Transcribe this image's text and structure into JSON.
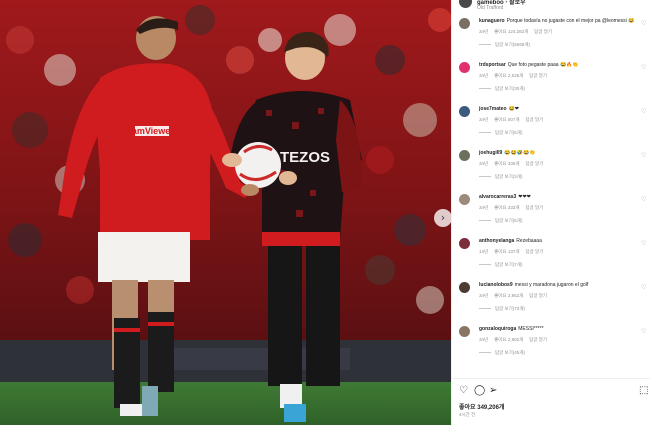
{
  "post": {
    "owner": "gameboo",
    "dot": "•",
    "follow_label": "팔로우",
    "location": "Old Trafford",
    "more_icon": "more-icon"
  },
  "photo": {
    "shirt_text": "TEZOS",
    "sponsor_text": "TeamViewer",
    "next_icon": "chevron-right-icon"
  },
  "comments": [
    {
      "user": "kunaguero",
      "text": "Porque todavía no jugaste con el mejor pa @leomessi 😂",
      "age": "34년",
      "likes": "좋아요 124,282개",
      "reply": "답글 달기",
      "replies": "답글 보기(5668개)",
      "avatar_color": "#7a6f63"
    },
    {
      "user": "trdsportsar",
      "text": "Que foto pegaste paaa 😂🔥👏",
      "age": "34년",
      "likes": "좋아요 2,535개",
      "reply": "답글 달기",
      "replies": "답글 보기(30개)",
      "avatar_color": "#e1306c"
    },
    {
      "user": "jose7mateo",
      "text": "😂❤",
      "age": "34년",
      "likes": "좋아요 507개",
      "reply": "답글 달기",
      "replies": "답글 보기(5개)",
      "avatar_color": "#3d5a80"
    },
    {
      "user": "joehugill9",
      "text": "😂😂🤣😂👏",
      "age": "34년",
      "likes": "좋아요 336개",
      "reply": "답글 달기",
      "replies": "답글 보기(3개)",
      "avatar_color": "#6b705c"
    },
    {
      "user": "alvarocarreras3",
      "text": "❤❤❤",
      "age": "34년",
      "likes": "좋아요 333개",
      "reply": "답글 달기",
      "replies": "답글 보기(5개)",
      "avatar_color": "#9c8b7a"
    },
    {
      "user": "anthonyelanga",
      "text": "Rezebaaaa",
      "age": "13년",
      "likes": "좋아요 137개",
      "reply": "답글 달기",
      "replies": "답글 보기(7개)",
      "avatar_color": "#7b2d3b"
    },
    {
      "user": "lucianolobos9",
      "text": "messi y maradona jugaron el golf",
      "age": "34년",
      "likes": "좋아요 2,952개",
      "reply": "답글 달기",
      "replies": "답글 보기(73개)",
      "avatar_color": "#4d3b33"
    },
    {
      "user": "gonzaloquiroga",
      "text": "MESSI*****",
      "age": "34년",
      "likes": "좋아요 2,902개",
      "reply": "답글 달기",
      "replies": "답글 보기(45개)",
      "avatar_color": "#8a7462"
    }
  ],
  "actions": {
    "like_icon": "heart-icon",
    "comment_icon": "comment-icon",
    "share_icon": "share-icon",
    "save_icon": "bookmark-icon",
    "likes_text": "좋아요 349,206개",
    "time_text": "4시간 전"
  },
  "colors": {
    "united_red": "#d01c1f",
    "panel_bg": "#ffffff",
    "muted_text": "#8e8e8e"
  }
}
